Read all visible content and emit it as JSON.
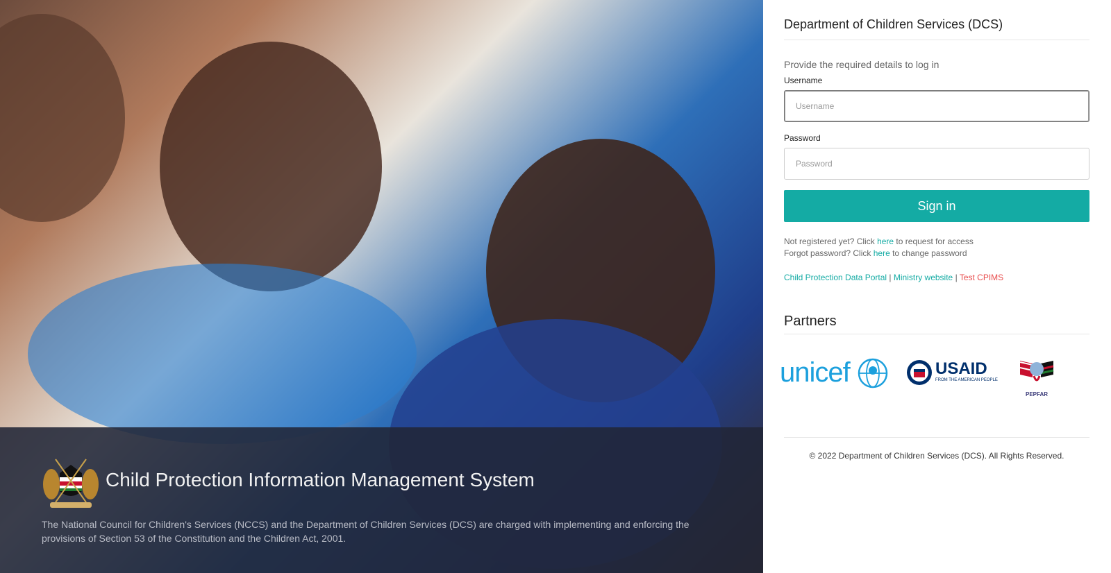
{
  "hero": {
    "system_title": "Child Protection Information Management System",
    "description": "The National Council for Children's Services (NCCS) and the Department of Children Services (DCS) are charged with implementing and enforcing the provisions of Section 53 of the Constitution and the Children Act, 2001."
  },
  "login": {
    "department_title": "Department of Children Services (DCS)",
    "subtitle": "Provide the required details to log in",
    "username_label": "Username",
    "username_placeholder": "Username",
    "password_label": "Password",
    "password_placeholder": "Password",
    "signin_label": "Sign in",
    "register_prefix": "Not registered yet? Click ",
    "register_link": "here",
    "register_suffix": " to request for access",
    "forgot_prefix": "Forgot password? Click ",
    "forgot_link": "here",
    "forgot_suffix": " to change password"
  },
  "links": {
    "portal": "Child Protection Data Portal",
    "ministry": "Ministry website",
    "test": "Test CPIMS",
    "separator": " | "
  },
  "partners": {
    "title": "Partners",
    "unicef": "unicef",
    "usaid": "USAID",
    "usaid_tagline": "FROM THE AMERICAN PEOPLE",
    "pepfar": "PEPFAR"
  },
  "footer": {
    "copyright": "© 2022 Department of Children Services (DCS). All Rights Reserved."
  },
  "colors": {
    "accent": "#14aba4",
    "test_link": "#e84a4a",
    "caption_bg": "#212537",
    "unicef_blue": "#1ca0dd",
    "usaid_blue": "#002f6c",
    "usaid_red": "#c8102e"
  }
}
